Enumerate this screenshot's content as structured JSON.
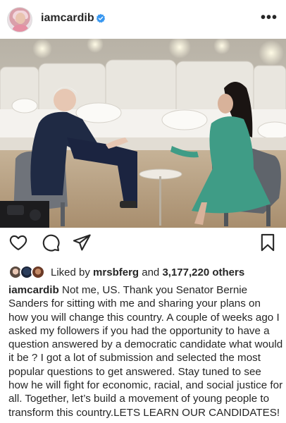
{
  "post": {
    "username": "iamcardib",
    "verified_icon": "verified-badge-icon",
    "more_icon": "more-options-icon",
    "more_label": "•••"
  },
  "actions": {
    "like_icon": "heart-icon",
    "comment_icon": "comment-icon",
    "share_icon": "send-icon",
    "save_icon": "bookmark-icon"
  },
  "likes": {
    "prefix": "Liked by",
    "user": "mrsbferg",
    "joiner": "and",
    "count": "3,177,220 others"
  },
  "caption": {
    "username": "iamcardib",
    "text": "Not me, US. Thank you Senator Bernie Sanders for sitting with me and sharing your plans on how you will change this country. A couple of weeks ago I asked my followers if you had the opportunity to have a question answered by a democratic candidate what would it be ? I got a lot of submission and selected the most popular questions to get answered. Stay tuned to see how he will fight for economic, racial, and social justice for all. Together, let’s build a movement of young people to transform this country.LETS LEARN OUR CANDIDATES!"
  },
  "colors": {
    "text": "#262626",
    "verified": "#3897f0"
  }
}
